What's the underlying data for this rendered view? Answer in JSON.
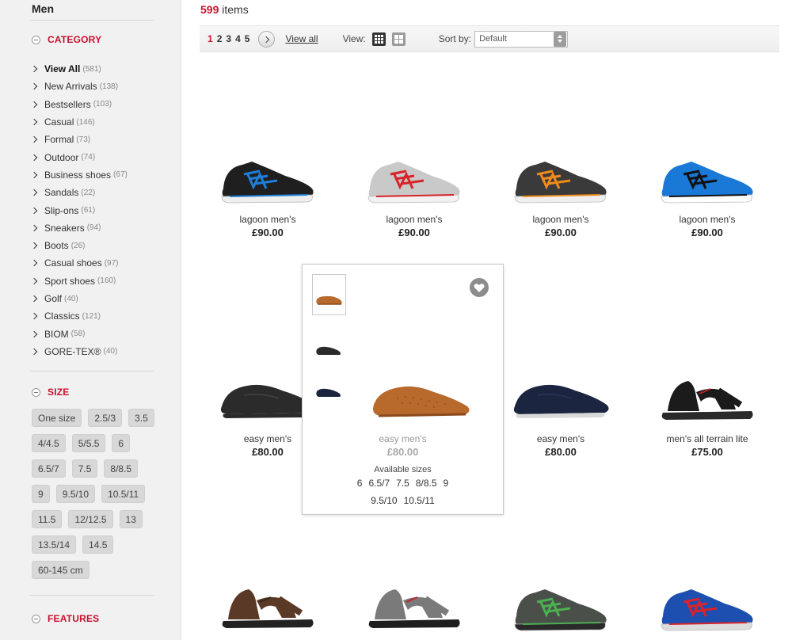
{
  "sidebar": {
    "title": "Men",
    "category": {
      "label": "CATEGORY",
      "items": [
        {
          "label": "View All",
          "count": "(581)",
          "active": true
        },
        {
          "label": "New Arrivals",
          "count": "(138)"
        },
        {
          "label": "Bestsellers",
          "count": "(103)"
        },
        {
          "label": "Casual",
          "count": "(146)"
        },
        {
          "label": "Formal",
          "count": "(73)"
        },
        {
          "label": "Outdoor",
          "count": "(74)"
        },
        {
          "label": "Business shoes",
          "count": "(67)"
        },
        {
          "label": "Sandals",
          "count": "(22)"
        },
        {
          "label": "Slip-ons",
          "count": "(61)"
        },
        {
          "label": "Sneakers",
          "count": "(94)"
        },
        {
          "label": "Boots",
          "count": "(26)"
        },
        {
          "label": "Casual shoes",
          "count": "(97)"
        },
        {
          "label": "Sport shoes",
          "count": "(160)"
        },
        {
          "label": "Golf",
          "count": "(40)"
        },
        {
          "label": "Classics",
          "count": "(121)"
        },
        {
          "label": "BIOM",
          "count": "(58)"
        },
        {
          "label": "GORE-TEX®",
          "count": "(40)"
        }
      ]
    },
    "size": {
      "label": "SIZE",
      "rows": [
        [
          "One size",
          "2.5/3",
          "3.5"
        ],
        [
          "4/4.5",
          "5/5.5",
          "6"
        ],
        [
          "6.5/7",
          "7.5",
          "8/8.5"
        ],
        [
          "9",
          "9.5/10",
          "10.5/11"
        ],
        [
          "11.5",
          "12/12.5",
          "13"
        ],
        [
          "13.5/14",
          "14.5"
        ],
        [
          "60-145 cm"
        ]
      ]
    },
    "features": {
      "label": "FEATURES"
    }
  },
  "results": {
    "count": "599",
    "suffix": "items"
  },
  "toolbar": {
    "pages": [
      "1",
      "2",
      "3",
      "4",
      "5"
    ],
    "current_page": "1",
    "view_all": "View all",
    "view_label": "View:",
    "sort_label": "Sort by:",
    "sort_value": "Default"
  },
  "products": [
    {
      "name": "lagoon men's",
      "price": "£90.00",
      "colors": {
        "upper": "#1f1f1f",
        "accent": "#1e7fd8",
        "sole": "#eeeeee"
      }
    },
    {
      "name": "lagoon men's",
      "price": "£90.00",
      "colors": {
        "upper": "#c9c9c9",
        "accent": "#d8232a",
        "sole": "#f2f2f2"
      }
    },
    {
      "name": "lagoon men's",
      "price": "£90.00",
      "colors": {
        "upper": "#3a3a3a",
        "accent": "#f08a1c",
        "sole": "#efefef"
      }
    },
    {
      "name": "lagoon men's",
      "price": "£90.00",
      "colors": {
        "upper": "#1a78d6",
        "accent": "#111111",
        "sole": "#ffffff"
      }
    },
    {
      "name": "easy men's",
      "price": "£80.00",
      "colors": {
        "upper": "#2b2b2b",
        "accent": "#444444",
        "sole": "#2b2b2b"
      }
    },
    {
      "name": "easy men's",
      "price": "£80.00",
      "colors": {
        "upper": "#b8692c",
        "accent": "#8a4a1c",
        "sole": "#c98a55"
      }
    },
    {
      "name": "easy men's",
      "price": "£80.00",
      "colors": {
        "upper": "#1c2540",
        "accent": "#2b3658",
        "sole": "#d9d9d9"
      }
    },
    {
      "name": "men's all terrain lite",
      "price": "£75.00",
      "colors": {
        "upper": "#1b1b1b",
        "accent": "#b22222",
        "sole": "#2a2a2a"
      }
    },
    {
      "name": "",
      "price": "",
      "colors": {
        "upper": "#5a3a26",
        "accent": "#3a2618",
        "sole": "#222222"
      }
    },
    {
      "name": "",
      "price": "",
      "colors": {
        "upper": "#7a7a7a",
        "accent": "#c2222a",
        "sole": "#1e1e1e"
      }
    },
    {
      "name": "",
      "price": "",
      "colors": {
        "upper": "#4a4f4a",
        "accent": "#4caf50",
        "sole": "#2a2a2a"
      }
    },
    {
      "name": "",
      "price": "",
      "colors": {
        "upper": "#1c4fb0",
        "accent": "#d8232a",
        "sole": "#dcdcdc"
      }
    }
  ],
  "quickview": {
    "name": "easy men's",
    "price": "£80.00",
    "available_label": "Available sizes",
    "sizes_line1": [
      "6",
      "6.5/7",
      "7.5",
      "8/8.5",
      "9"
    ],
    "sizes_line2": [
      "9.5/10",
      "10.5/11"
    ],
    "thumb_colors": [
      "#b8692c",
      "#2b2b2b",
      "#1c2540"
    ]
  }
}
